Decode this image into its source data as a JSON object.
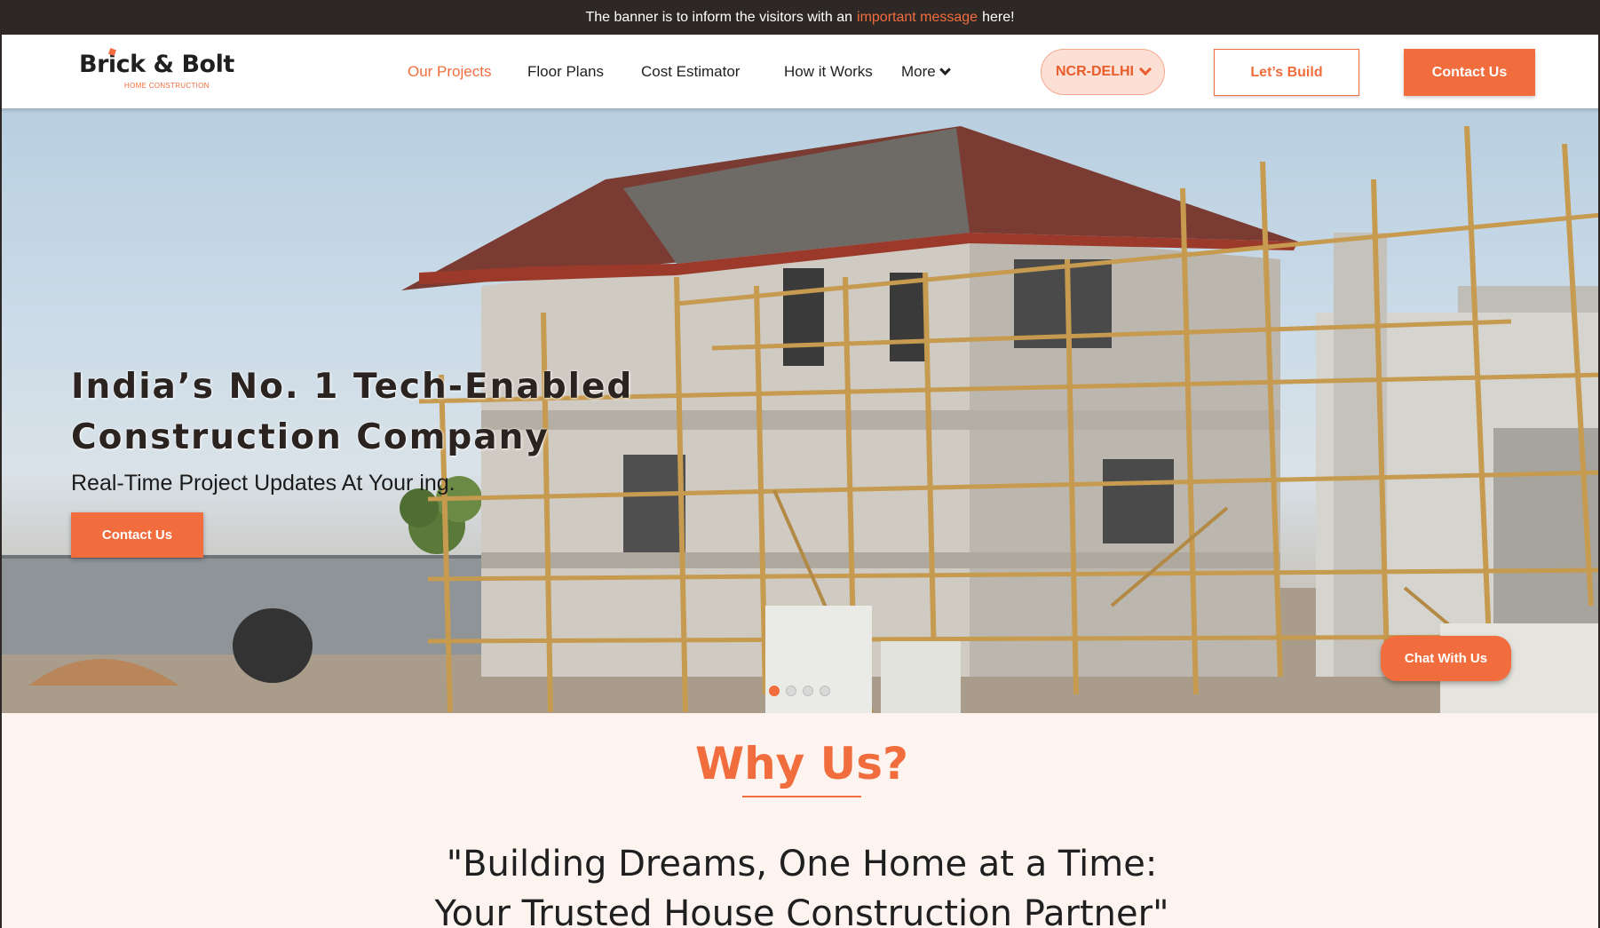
{
  "banner": {
    "text_before": "The banner is to inform the visitors with an",
    "highlight": "important message",
    "text_after": "here!"
  },
  "logo": {
    "name": "Brick & Bolt",
    "tagline": "HOME CONSTRUCTION"
  },
  "nav": {
    "items": [
      "Our Projects",
      "Floor Plans",
      "Cost Estimator",
      "How it Works"
    ],
    "more_label": "More",
    "active_index": 0
  },
  "region": {
    "selected": "NCR-DELHI"
  },
  "header_buttons": {
    "build_label": "Let’s Build",
    "contact_label": "Contact Us"
  },
  "hero": {
    "title_line1": "India’s No. 1 Tech-Enabled",
    "title_line2": "Construction Company",
    "subtitle": "Real-Time Project Updates At Your ing.",
    "button_label": "Contact Us",
    "slide_count": 4,
    "active_slide": 0,
    "chat_label": "Chat With Us"
  },
  "why": {
    "title": "Why Us?",
    "quote_line1": "\"Building Dreams, One Home at a Time:",
    "quote_line2": "Your Trusted House Construction Partner\""
  },
  "colors": {
    "accent": "#f26d3d",
    "banner_bg": "#2d2826",
    "section_bg": "#fdf3ef",
    "region_bg": "#fde0d5"
  }
}
